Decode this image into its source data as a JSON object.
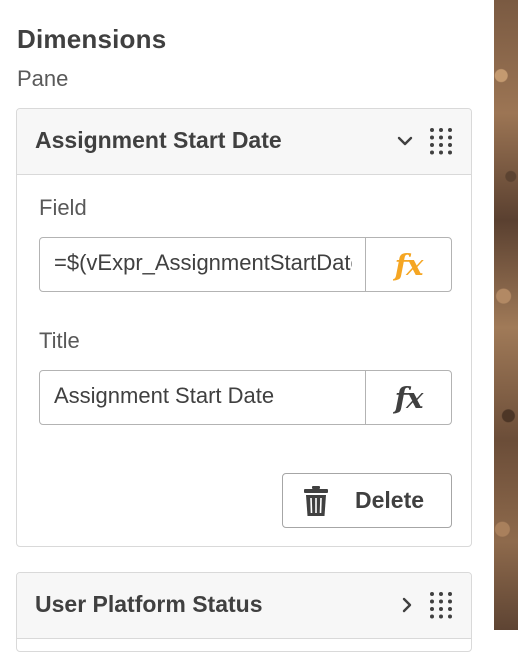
{
  "pane": {
    "title": "Dimensions",
    "subtitle": "Pane"
  },
  "dimensions": [
    {
      "title": "Assignment Start Date",
      "expanded": true,
      "field_label": "Field",
      "field_value": "=$(vExpr_AssignmentStartDate)",
      "title_label": "Title",
      "title_value": "Assignment Start Date",
      "delete_label": "Delete"
    },
    {
      "title": "User Platform Status",
      "expanded": false
    }
  ],
  "icons": {
    "expression_button": "fx",
    "collapse": "chevron-down-icon",
    "expand": "chevron-right-icon",
    "drag": "drag-handle-icon",
    "delete": "trash-icon"
  },
  "colors": {
    "fx_active": "#f5a623",
    "fx_inactive": "#404040"
  }
}
